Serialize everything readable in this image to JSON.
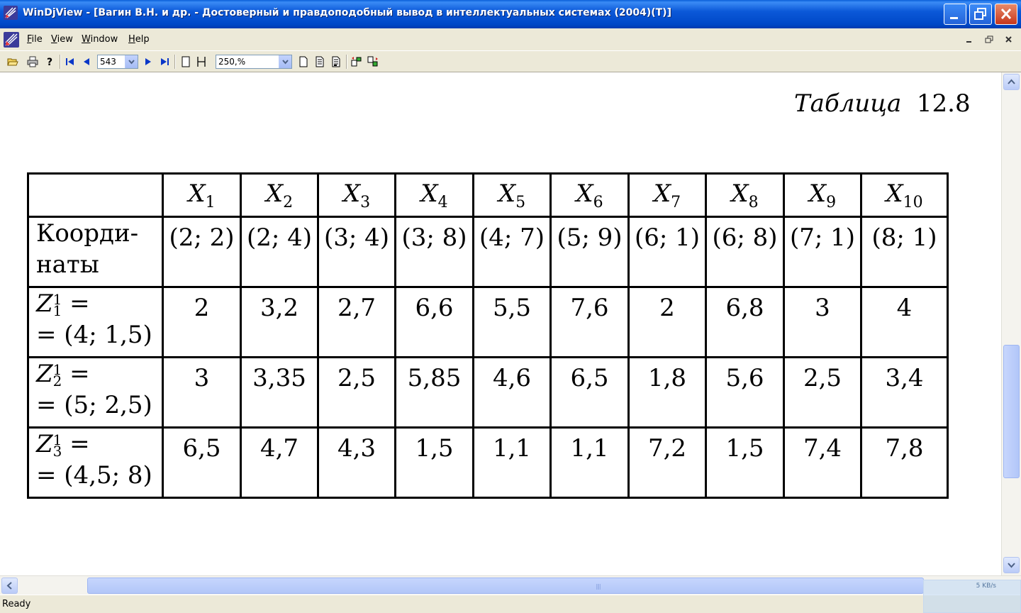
{
  "window": {
    "title": "WinDjView - [Вагин В.Н. и др. - Достоверный и правдоподобный вывод в интеллектуальных системах (2004)(T)]"
  },
  "menu": {
    "items": [
      {
        "label": "File",
        "accel": "F",
        "rest": "ile"
      },
      {
        "label": "View",
        "accel": "V",
        "rest": "iew"
      },
      {
        "label": "Window",
        "accel": "W",
        "rest": "indow"
      },
      {
        "label": "Help",
        "accel": "H",
        "rest": "elp"
      }
    ]
  },
  "toolbar": {
    "page_number": "543",
    "zoom": "250,%"
  },
  "document": {
    "caption_word": "Таблица",
    "caption_number": "12.8",
    "table": {
      "columns": [
        "X",
        "X",
        "X",
        "X",
        "X",
        "X",
        "X",
        "X",
        "X",
        "X"
      ],
      "column_subs": [
        "1",
        "2",
        "3",
        "4",
        "5",
        "6",
        "7",
        "8",
        "9",
        "10"
      ],
      "coord_label_line1": "Коорди-",
      "coord_label_line2": "наты",
      "coords": [
        "(2; 2)",
        "(2; 4)",
        "(3; 4)",
        "(3; 8)",
        "(4; 7)",
        "(5; 9)",
        "(6; 1)",
        "(6; 8)",
        "(7; 1)",
        "(8; 1)"
      ],
      "rows": [
        {
          "z": "Z",
          "sup": "1",
          "sub": "1",
          "eq": " =",
          "line2": "= (4; 1,5)",
          "values": [
            "2",
            "3,2",
            "2,7",
            "6,6",
            "5,5",
            "7,6",
            "2",
            "6,8",
            "3",
            "4"
          ]
        },
        {
          "z": "Z",
          "sup": "1",
          "sub": "2",
          "eq": " =",
          "line2": "= (5; 2,5)",
          "values": [
            "3",
            "3,35",
            "2,5",
            "5,85",
            "4,6",
            "6,5",
            "1,8",
            "5,6",
            "2,5",
            "3,4"
          ]
        },
        {
          "z": "Z",
          "sup": "1",
          "sub": "3",
          "eq": " =",
          "line2": "= (4,5; 8)",
          "values": [
            "6,5",
            "4,7",
            "4,3",
            "1,5",
            "1,1",
            "1,1",
            "7,2",
            "1,5",
            "7,4",
            "7,8"
          ]
        }
      ]
    }
  },
  "status": {
    "text": "Ready",
    "net_speed": "5 KB/s"
  }
}
